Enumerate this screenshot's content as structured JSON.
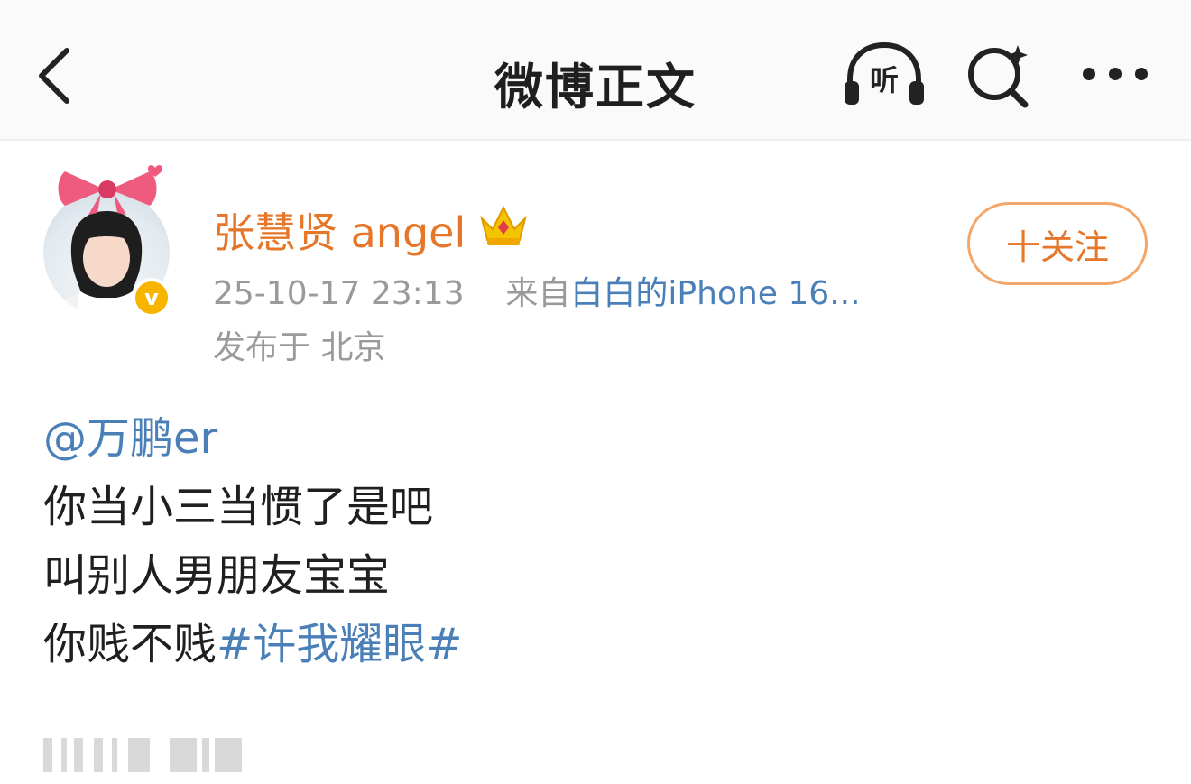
{
  "header": {
    "title": "微博正文",
    "listen_label": "听"
  },
  "post": {
    "author": {
      "name": "张慧贤 angel",
      "verified_mark": "v"
    },
    "follow_label": "十关注",
    "timestamp": "25-10-17 23:13",
    "source_prefix": "来自",
    "source_device": "白白的iPhone 16...",
    "location": "发布于 北京",
    "mention": "@万鹏er",
    "lines": [
      "你当小三当惯了是吧",
      "叫别人男朋友宝宝",
      "你贱不贱"
    ],
    "hashtag": "#许我耀眼#"
  },
  "colors": {
    "accent_orange": "#e5762a",
    "link_blue": "#4a7fb8",
    "badge_gold": "#f7b500"
  },
  "icons": [
    "back-arrow-icon",
    "headphones-icon",
    "search-sparkle-icon",
    "more-dots-icon",
    "bow-icon",
    "crown-icon"
  ]
}
